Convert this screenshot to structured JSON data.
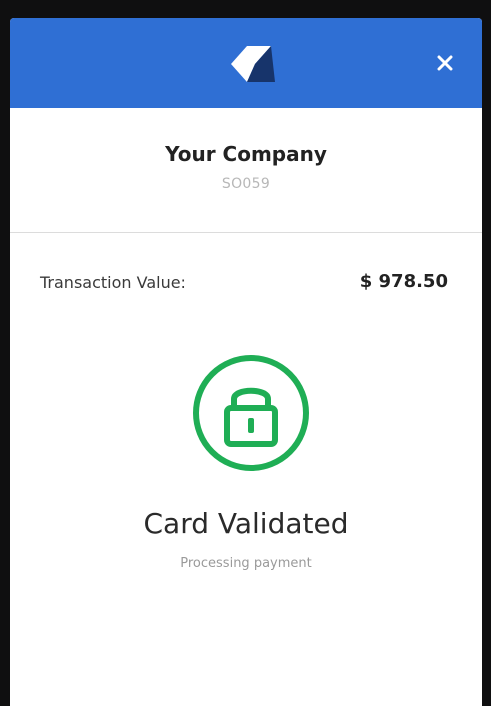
{
  "header": {
    "brand_color": "#2f6fd4",
    "logo_icon": "payment-logo",
    "close_icon": "close-icon"
  },
  "company": {
    "name": "Your Company",
    "order_number": "SO059"
  },
  "transaction": {
    "label": "Transaction Value:",
    "value": "$ 978.50"
  },
  "status": {
    "icon": "lock-icon",
    "icon_color": "#1fae55",
    "title": "Card Validated",
    "subtitle": "Processing payment"
  }
}
